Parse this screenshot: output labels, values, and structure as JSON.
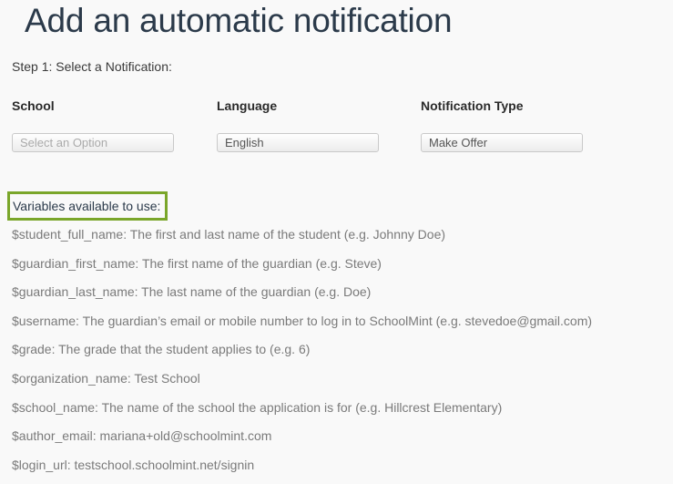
{
  "page": {
    "title": "Add an automatic notification",
    "step_label": "Step 1: Select a Notification:"
  },
  "fields": {
    "school": {
      "label": "School",
      "value": "Select an Option"
    },
    "language": {
      "label": "Language",
      "value": "English"
    },
    "notification_type": {
      "label": "Notification Type",
      "value": "Make Offer"
    }
  },
  "variables": {
    "heading": "Variables available to use:",
    "items": [
      "$student_full_name: The first and last name of the student (e.g. Johnny Doe)",
      "$guardian_first_name: The first name of the guardian (e.g. Steve)",
      "$guardian_last_name: The last name of the guardian (e.g. Doe)",
      "$username: The guardian’s email or mobile number to log in to SchoolMint (e.g. stevedoe@gmail.com)",
      "$grade: The grade that the student applies to (e.g. 6)",
      "$organization_name: Test School",
      "$school_name: The name of the school the application is for (e.g. Hillcrest Elementary)",
      "$author_email: mariana+old@schoolmint.com",
      "$login_url: testschool.schoolmint.net/signin"
    ]
  },
  "colors": {
    "highlight_border": "#7aa62a",
    "title": "#2b3a4a",
    "variable_text": "#7a7a7a"
  }
}
